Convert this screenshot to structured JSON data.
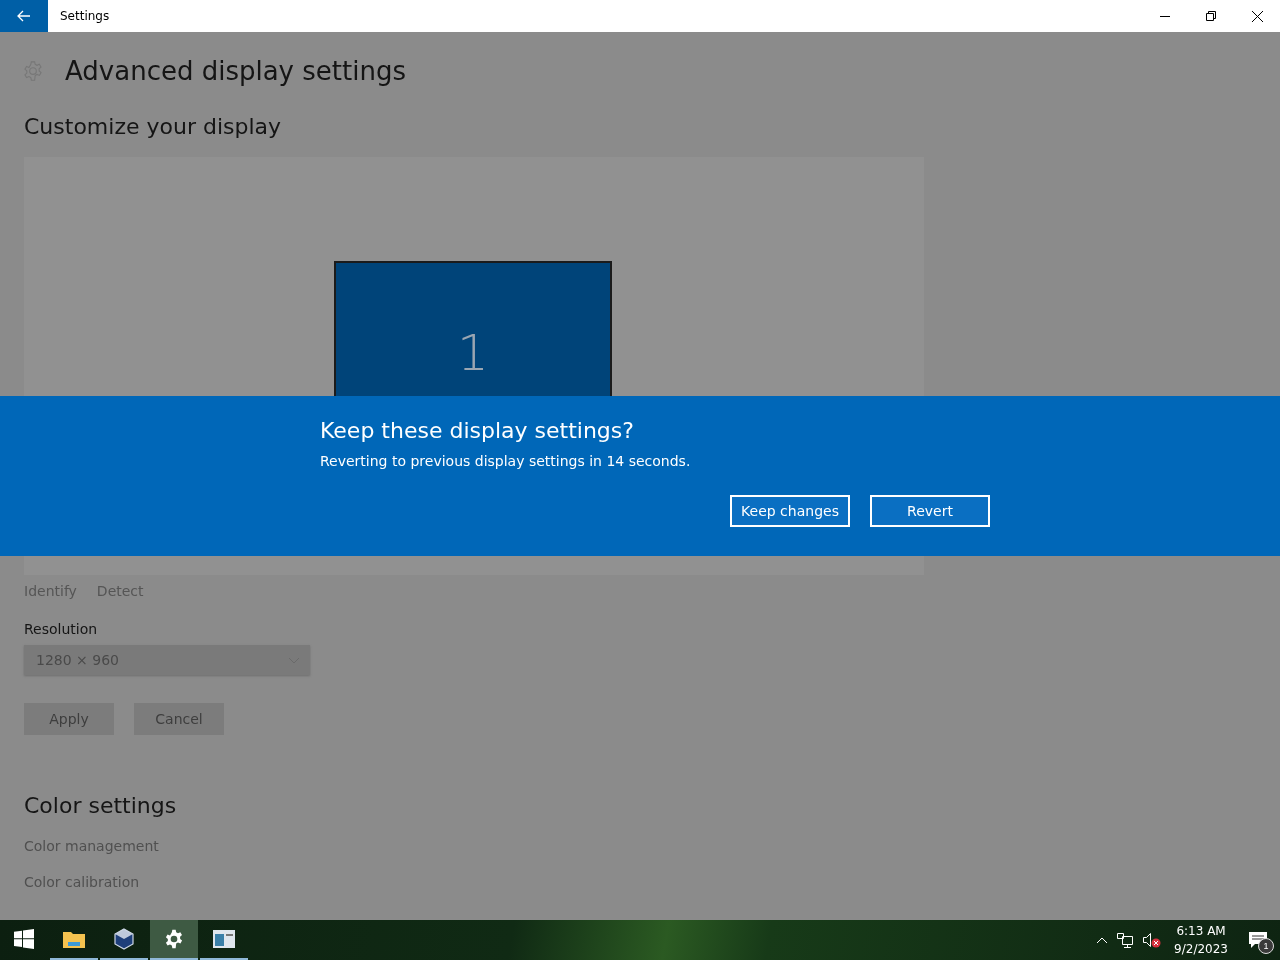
{
  "window": {
    "title": "Settings"
  },
  "page": {
    "title": "Advanced display settings",
    "section": "Customize your display",
    "monitor_label": "1",
    "links": [
      {
        "label": "Identify",
        "disabled": true
      },
      {
        "label": "Detect",
        "disabled": true
      }
    ],
    "resolution": {
      "label": "Resolution",
      "value": "1280 × 960",
      "disabled": true
    },
    "buttons": [
      {
        "label": "Apply",
        "disabled": true
      },
      {
        "label": "Cancel",
        "disabled": true
      }
    ],
    "color_section": "Color settings",
    "color_links": [
      {
        "label": "Color management"
      },
      {
        "label": "Color calibration"
      }
    ]
  },
  "dialog": {
    "title": "Keep these display settings?",
    "message": "Reverting to previous display settings in 14 seconds.",
    "buttons": [
      "Keep changes",
      "Revert"
    ]
  },
  "taskbar": {
    "apps": [
      {
        "kind": "start",
        "running": false,
        "selected": false
      },
      {
        "kind": "folder",
        "running": true,
        "selected": false
      },
      {
        "kind": "cube",
        "running": true,
        "selected": false
      },
      {
        "kind": "gear",
        "running": true,
        "selected": true
      },
      {
        "kind": "window",
        "running": true,
        "selected": false
      }
    ],
    "time": "6:13 AM",
    "date": "9/2/2023",
    "notification_count": "1",
    "volume_muted": true
  }
}
